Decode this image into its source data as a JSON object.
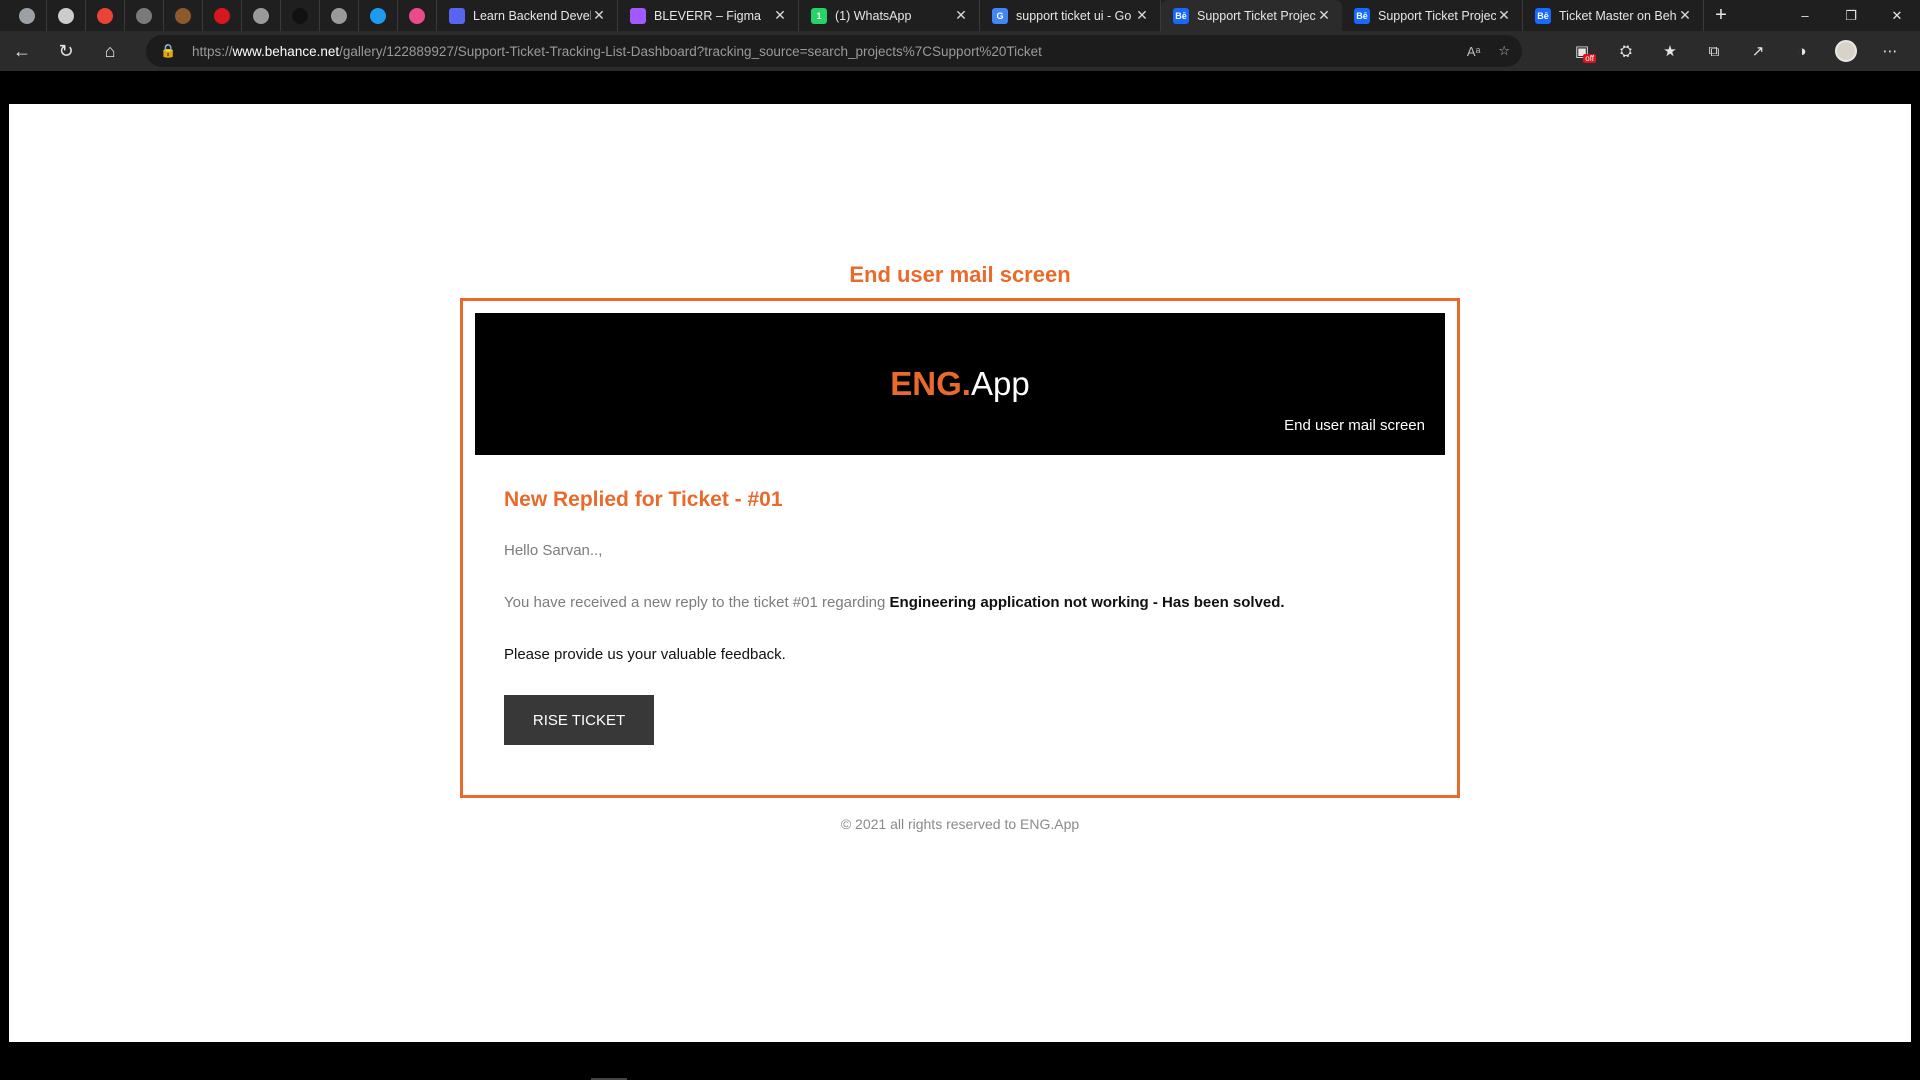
{
  "browser": {
    "pinned_tabs": [
      {
        "icon": "toggle-icon",
        "color": "#9aa0a6"
      },
      {
        "icon": "github-icon",
        "color": "#cccccc"
      },
      {
        "icon": "gmail-icon",
        "color": "#ea4335"
      },
      {
        "icon": "circle-app-icon",
        "color": "#7a7a7a"
      },
      {
        "icon": "b-app-icon",
        "color": "#8a5a2b"
      },
      {
        "icon": "adobe-icon",
        "color": "#d6171d"
      },
      {
        "icon": "document-icon",
        "color": "#9a9a9a"
      },
      {
        "icon": "notion-icon",
        "color": "#111111"
      },
      {
        "icon": "document-icon",
        "color": "#9a9a9a"
      },
      {
        "icon": "twitter-icon",
        "color": "#1d9bf0"
      },
      {
        "icon": "dribbble-icon",
        "color": "#ea4c89"
      }
    ],
    "tabs": [
      {
        "title": "Learn Backend Develo",
        "fav_color": "#5865f2",
        "fav_text": "",
        "active": false
      },
      {
        "title": "BLEVERR – Figma",
        "fav_color": "#a259ff",
        "fav_text": "",
        "active": false
      },
      {
        "title": "(1) WhatsApp",
        "fav_color": "#25d366",
        "fav_text": "1",
        "active": false
      },
      {
        "title": "support ticket ui - Go",
        "fav_color": "#4285f4",
        "fav_text": "G",
        "active": false
      },
      {
        "title": "Support Ticket Projec",
        "fav_color": "#1769ff",
        "fav_text": "Bē",
        "active": true
      },
      {
        "title": "Support Ticket Projec",
        "fav_color": "#1769ff",
        "fav_text": "Bē",
        "active": false
      },
      {
        "title": "Ticket Master on Beh",
        "fav_color": "#1769ff",
        "fav_text": "Bē",
        "active": false
      }
    ],
    "url_prefix": "https://",
    "url_host": "www.behance.net",
    "url_path": "/gallery/122889927/Support-Ticket-Tracking-List-Dashboard?tracking_source=search_projects%7CSupport%20Ticket",
    "badge_off": "off"
  },
  "page": {
    "heading": "End user mail screen",
    "logo_part1": "ENG.",
    "logo_part2": "App",
    "banner_subtitle": "End user mail screen",
    "ticket_title": "New Replied for Ticket - #01",
    "greeting": "Hello Sarvan..,",
    "message_prefix": "You have received a new reply to the ticket #01 regarding ",
    "message_bold": "Engineering application not working - Has been solved.",
    "feedback": "Please provide us your valuable feedback.",
    "button_label": "RISE TICKET",
    "footer": "© 2021 all rights reserved to ENG.App"
  },
  "colors": {
    "accent": "#ea6a2c",
    "button": "#383838",
    "banner": "#000000"
  }
}
